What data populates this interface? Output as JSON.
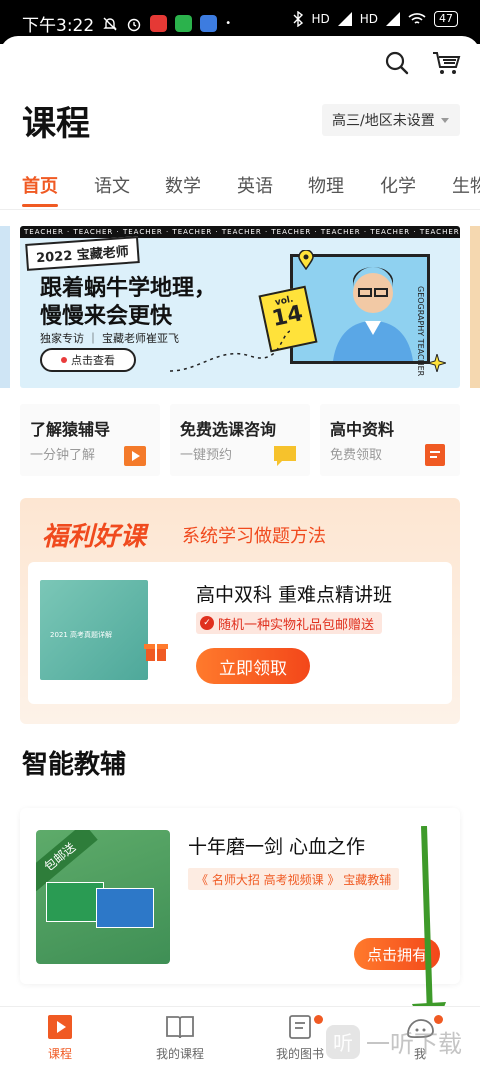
{
  "status_bar": {
    "time": "下午3:22",
    "network_1": "HD",
    "network_2": "HD",
    "battery": "47"
  },
  "header": {
    "title": "课程",
    "grade_select": "高三/地区未设置",
    "search_icon": "search-icon",
    "cart_icon": "cart-icon"
  },
  "tabs": [
    {
      "label": "首页",
      "active": true
    },
    {
      "label": "语文"
    },
    {
      "label": "数学"
    },
    {
      "label": "英语"
    },
    {
      "label": "物理"
    },
    {
      "label": "化学"
    },
    {
      "label": "生物"
    }
  ],
  "banner": {
    "ribbon": "TEACHER · TEACHER · TEACHER · TEACHER · TEACHER · TEACHER · TEACHER · TEACHER · TEACHER · TEACHER",
    "tag": "2022 宝藏老师",
    "headline_1": "跟着蜗牛学地理，",
    "headline_2": "慢慢来会更快",
    "subline": "独家专访 ｜ 宝藏老师崔亚飞",
    "button": "点击查看",
    "vol_label": "vol.",
    "vol_number": "14",
    "vertical_text": "GEOGRAPHY TEACHER"
  },
  "quick_cards": [
    {
      "title": "了解猿辅导",
      "subtitle": "一分钟了解",
      "icon": "play-icon",
      "color": "#f47a2a"
    },
    {
      "title": "免费选课咨询",
      "subtitle": "一键预约",
      "icon": "chat-bubble-icon",
      "color": "#f6c22c"
    },
    {
      "title": "高中资料",
      "subtitle": "免费领取",
      "icon": "document-icon",
      "color": "#f05a23"
    }
  ],
  "promo": {
    "title": "福利好课",
    "subtitle": "系统学习做题方法",
    "course_title": "高中双科 重难点精讲班",
    "gift": "随机一种实物礼品包邮赠送",
    "button": "立即领取",
    "book_text": "2021 高考真题详解"
  },
  "section": {
    "title": "智能教辅"
  },
  "tutor_card": {
    "title": "十年磨一剑 心血之作",
    "tag": "《 名师大招 高考视频课 》 宝藏教辅",
    "badge": "包邮送",
    "button": "点击拥有"
  },
  "bottom_nav": [
    {
      "label": "课程",
      "icon": "play-course-icon",
      "active": true
    },
    {
      "label": "我的课程",
      "icon": "book-icon"
    },
    {
      "label": "我的图书",
      "icon": "notebook-icon",
      "dot": true
    },
    {
      "label": "我",
      "icon": "profile-icon",
      "dot": true
    }
  ],
  "watermark": {
    "icon_char": "听",
    "text": "一听下载"
  },
  "colors": {
    "accent": "#f05a23",
    "arrow": "#3e9a2a"
  }
}
